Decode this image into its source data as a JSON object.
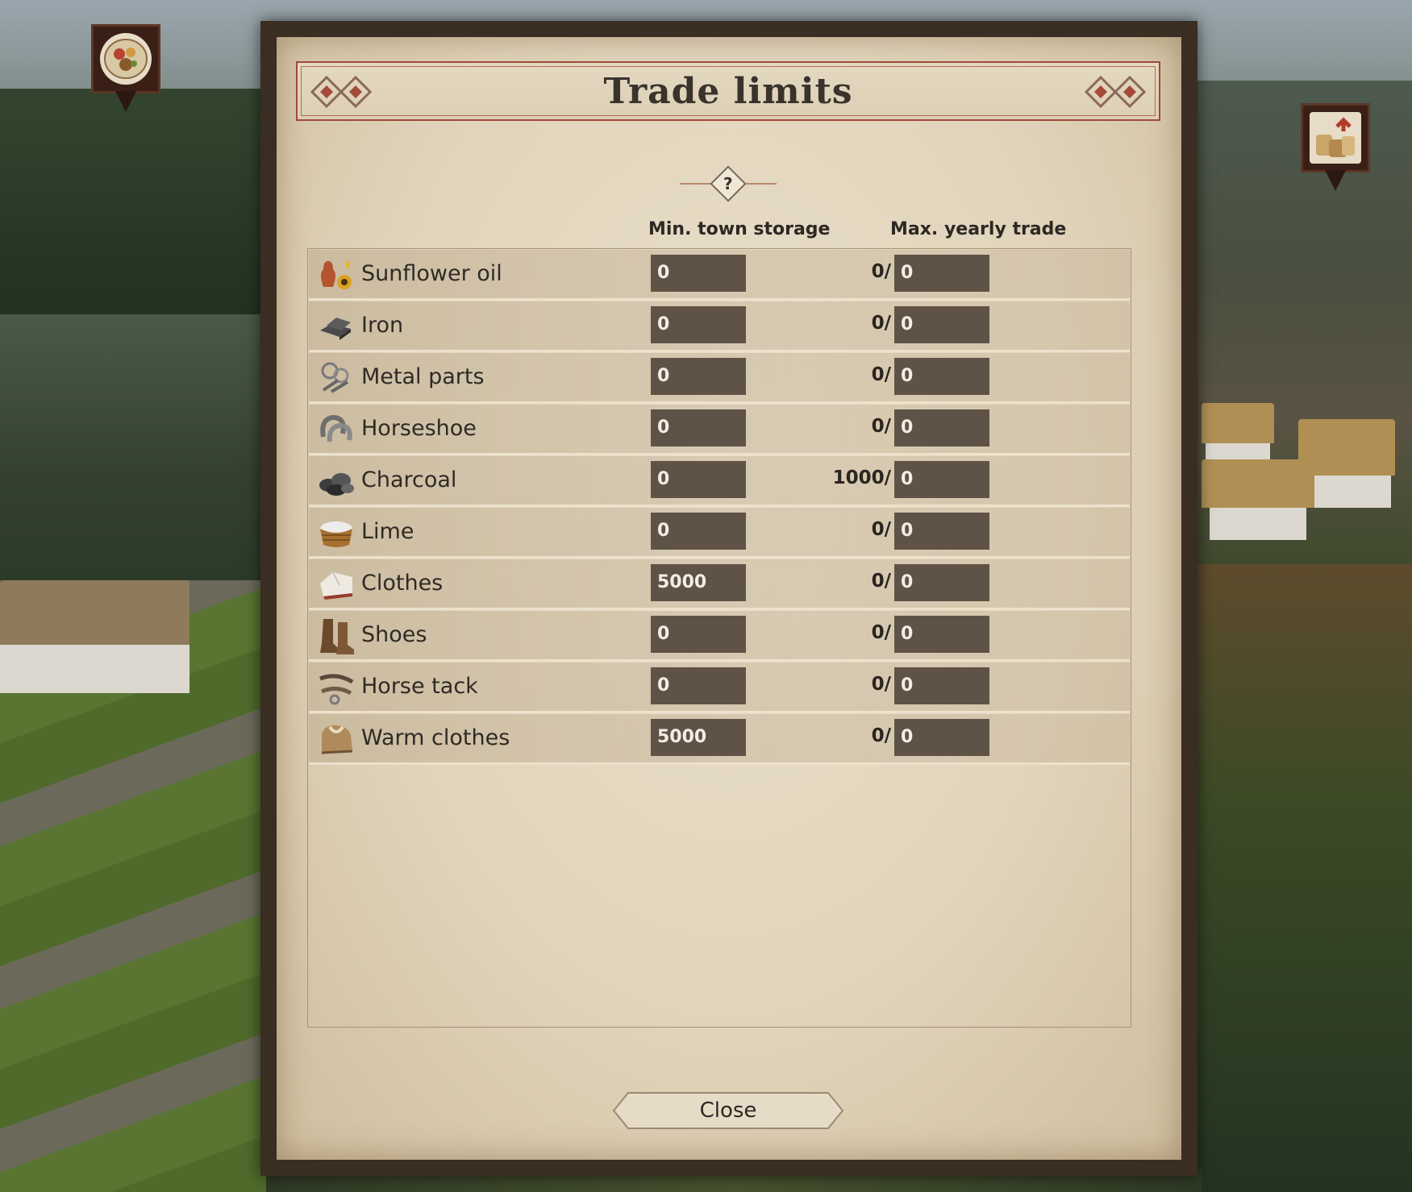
{
  "dialog": {
    "title": "Trade limits",
    "help_label": "?",
    "columns": {
      "min_storage": "Min. town storage",
      "max_trade": "Max. yearly trade"
    },
    "close_label": "Close"
  },
  "goods": [
    {
      "name": "Sunflower oil",
      "icon": "sunflower-oil-icon",
      "min_storage": "0",
      "current": "0/",
      "max_trade": "0"
    },
    {
      "name": "Iron",
      "icon": "iron-icon",
      "min_storage": "0",
      "current": "0/",
      "max_trade": "0"
    },
    {
      "name": "Metal parts",
      "icon": "metal-parts-icon",
      "min_storage": "0",
      "current": "0/",
      "max_trade": "0"
    },
    {
      "name": "Horseshoe",
      "icon": "horseshoe-icon",
      "min_storage": "0",
      "current": "0/",
      "max_trade": "0"
    },
    {
      "name": "Charcoal",
      "icon": "charcoal-icon",
      "min_storage": "0",
      "current": "1000/",
      "max_trade": "0"
    },
    {
      "name": "Lime",
      "icon": "lime-basket-icon",
      "min_storage": "0",
      "current": "0/",
      "max_trade": "0"
    },
    {
      "name": "Clothes",
      "icon": "clothes-icon",
      "min_storage": "5000",
      "current": "0/",
      "max_trade": "0"
    },
    {
      "name": "Shoes",
      "icon": "shoes-icon",
      "min_storage": "0",
      "current": "0/",
      "max_trade": "0"
    },
    {
      "name": "Horse tack",
      "icon": "horse-tack-icon",
      "min_storage": "0",
      "current": "0/",
      "max_trade": "0"
    },
    {
      "name": "Warm clothes",
      "icon": "warm-clothes-icon",
      "min_storage": "5000",
      "current": "0/",
      "max_trade": "0"
    }
  ],
  "markers": [
    {
      "icon": "food-plate-icon"
    },
    {
      "icon": "export-goods-icon"
    }
  ],
  "colors": {
    "parchment": "#e4d8c1",
    "panel_frame": "#3a2d22",
    "input_bg": "#5f5347",
    "title_border": "#9e4a3a"
  }
}
